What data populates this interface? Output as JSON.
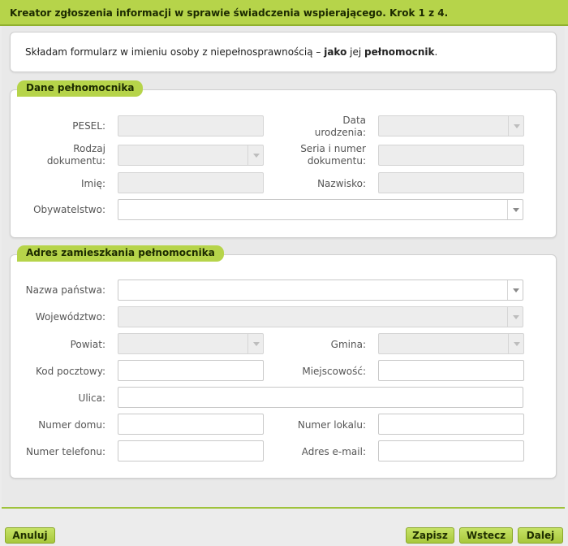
{
  "header": {
    "title": "Kreator zgłoszenia informacji w sprawie świadczenia wspierającego. Krok 1 z 4."
  },
  "intro": {
    "prefix": "Składam formularz w imieniu osoby z niepełnosprawnością – ",
    "bold1": "jako",
    "middle": " jej ",
    "bold2": "pełnomocnik",
    "suffix": "."
  },
  "section_proxy": {
    "legend": "Dane pełnomocnika",
    "pesel_label": "PESEL:",
    "birth_date_label": "Data urodzenia:",
    "doc_type_label": "Rodzaj dokumentu:",
    "doc_number_label": "Seria i numer dokumentu:",
    "first_name_label": "Imię:",
    "last_name_label": "Nazwisko:",
    "citizenship_label": "Obywatelstwo:"
  },
  "section_address": {
    "legend": "Adres zamieszkania pełnomocnika",
    "country_label": "Nazwa państwa:",
    "voivodeship_label": "Województwo:",
    "district_label": "Powiat:",
    "commune_label": "Gmina:",
    "postal_label": "Kod pocztowy:",
    "city_label": "Miejscowość:",
    "street_label": "Ulica:",
    "house_label": "Numer domu:",
    "apartment_label": "Numer lokalu:",
    "phone_label": "Numer telefonu:",
    "email_label": "Adres e-mail:"
  },
  "footer": {
    "cancel": "Anuluj",
    "save": "Zapisz",
    "back": "Wstecz",
    "next": "Dalej"
  },
  "colors": {
    "accent": "#b6d44a",
    "accent_border": "#8fb02e",
    "frame_bg": "#e9e9e9"
  }
}
